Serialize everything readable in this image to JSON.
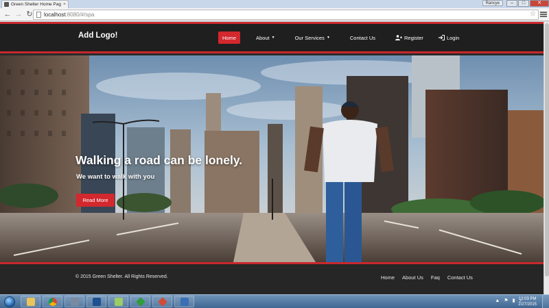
{
  "browser": {
    "tab_title": "Green Shelter Home Page",
    "tab_close": "×",
    "profile_label": "Rancye",
    "url_host": "localhost",
    "url_rest": ":8080/#/spa",
    "back": "←",
    "forward": "→",
    "reload": "↻",
    "star": "☆"
  },
  "site": {
    "logo": "Add Logo!",
    "nav": {
      "home": "Home",
      "about": "About",
      "services": "Our Services",
      "contact": "Contact Us",
      "register": "Register",
      "login": "Login"
    },
    "hero": {
      "title": "Walking a road can be lonely.",
      "subtitle": "We want to walk with you",
      "button": "Read More"
    },
    "footer": {
      "copyright": "© 2015 Green Shelter. All Rights Reserved.",
      "links": [
        "Home",
        "About Us",
        "Faq",
        "Contact Us"
      ]
    },
    "colors": {
      "accent": "#d2282e",
      "nav_bg": "#1f1f1f",
      "footer_bg": "#262626"
    }
  },
  "taskbar": {
    "time": "12:03 PM",
    "date": "2/27/2015",
    "apps": [
      "windows-explorer",
      "chrome",
      "tools",
      "powershell",
      "notepad-plus",
      "green-app",
      "red-app",
      "project"
    ]
  }
}
